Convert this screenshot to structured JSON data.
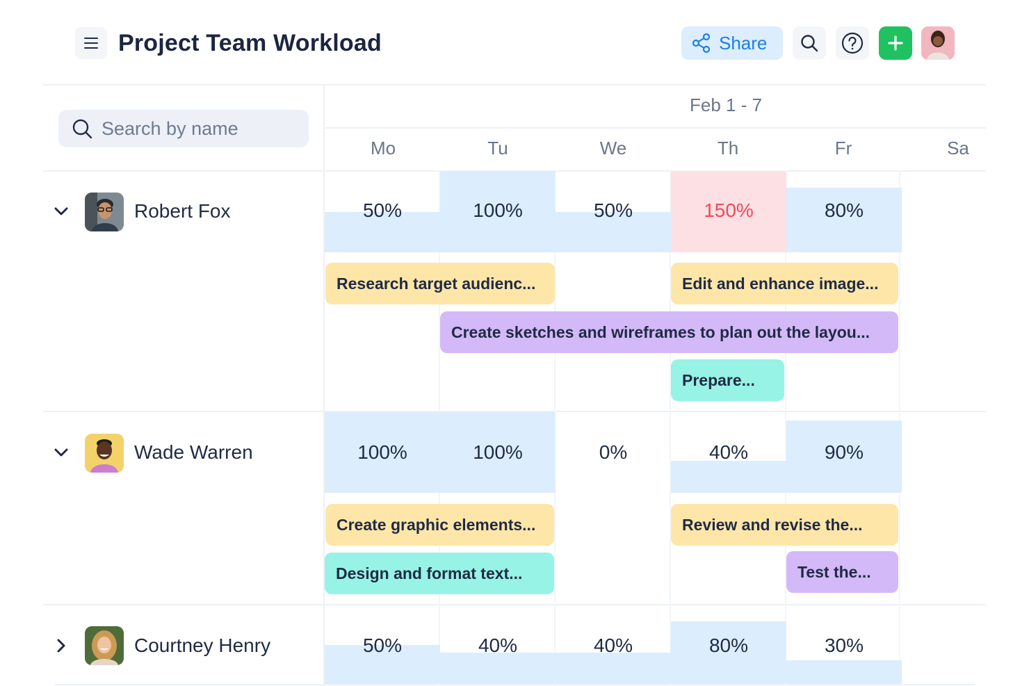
{
  "header": {
    "title": "Project Team Workload",
    "share_label": "Share",
    "icons": [
      "menu-icon",
      "share-icon",
      "search-icon",
      "help-icon",
      "plus-icon"
    ],
    "colors": {
      "share_bg": "#dcedfd",
      "share_text": "#1c7fe6",
      "add_bg": "#20c160"
    }
  },
  "search": {
    "placeholder": "Search by name",
    "value": ""
  },
  "calendar": {
    "range": "Feb 1 - 7",
    "days": [
      "Mo",
      "Tu",
      "We",
      "Th",
      "Fr",
      "Sa"
    ]
  },
  "people": [
    {
      "name": "Robert Fox",
      "expanded": true,
      "workload": [
        "50%",
        "100%",
        "50%",
        "150%",
        "80%"
      ],
      "workload_fraction": [
        0.5,
        1.0,
        0.5,
        1.5,
        0.8
      ],
      "tasks": [
        "Research target audienc...",
        "Edit and enhance image...",
        "Create sketches and wireframes to plan out the layou...",
        "Prepare..."
      ]
    },
    {
      "name": "Wade Warren",
      "expanded": true,
      "workload": [
        "100%",
        "100%",
        "0%",
        "40%",
        "90%"
      ],
      "workload_fraction": [
        1.0,
        1.0,
        0.0,
        0.4,
        0.9
      ],
      "tasks": [
        "Create graphic elements...",
        "Review and revise the...",
        "Design and format text...",
        "Test the..."
      ]
    },
    {
      "name": "Courtney Henry",
      "expanded": false,
      "workload": [
        "50%",
        "40%",
        "40%",
        "80%",
        "30%"
      ],
      "workload_fraction": [
        0.5,
        0.4,
        0.4,
        0.8,
        0.3
      ]
    }
  ],
  "colors": {
    "capacity_fill": "#dcedfd",
    "over_capacity_fill": "#fde0e3",
    "over_capacity_text": "#ef4a5c",
    "task_yellow": "#fde6a8",
    "task_purple": "#d3b9f8",
    "task_teal": "#97f3e5"
  }
}
